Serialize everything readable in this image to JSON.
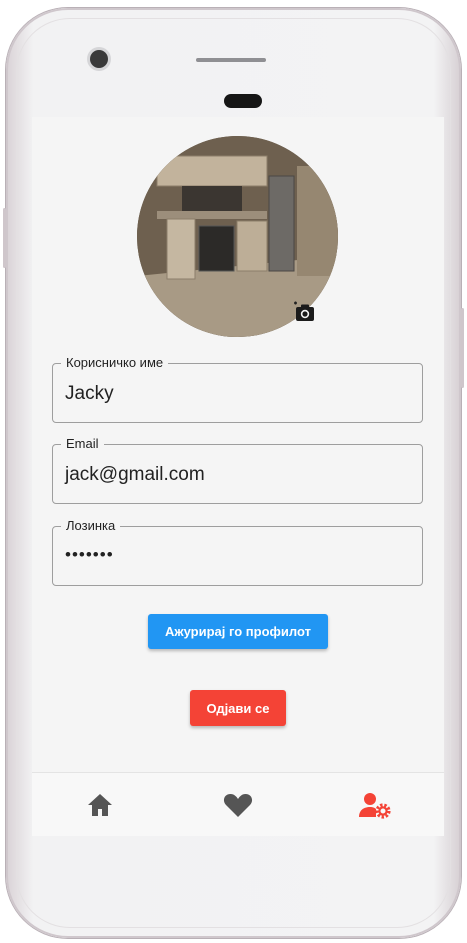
{
  "profile": {
    "avatar_alt": "Profile photo",
    "username_label": "Корисничко име",
    "username_value": "Jacky",
    "email_label": "Email",
    "email_value": "jack@gmail.com",
    "password_label": "Лозинка",
    "password_value": "•••••••"
  },
  "actions": {
    "update_label": "Ажурирај го профилот",
    "logout_label": "Одјави се"
  },
  "bottom_nav": {
    "items": [
      {
        "name": "home",
        "icon": "home-icon",
        "active": false
      },
      {
        "name": "favorites",
        "icon": "heart-icon",
        "active": false
      },
      {
        "name": "account-settings",
        "icon": "user-settings-icon",
        "active": true
      }
    ]
  },
  "colors": {
    "primary": "#2196f3",
    "danger": "#f44336",
    "nav_inactive": "#555555",
    "nav_active": "#f44336"
  }
}
